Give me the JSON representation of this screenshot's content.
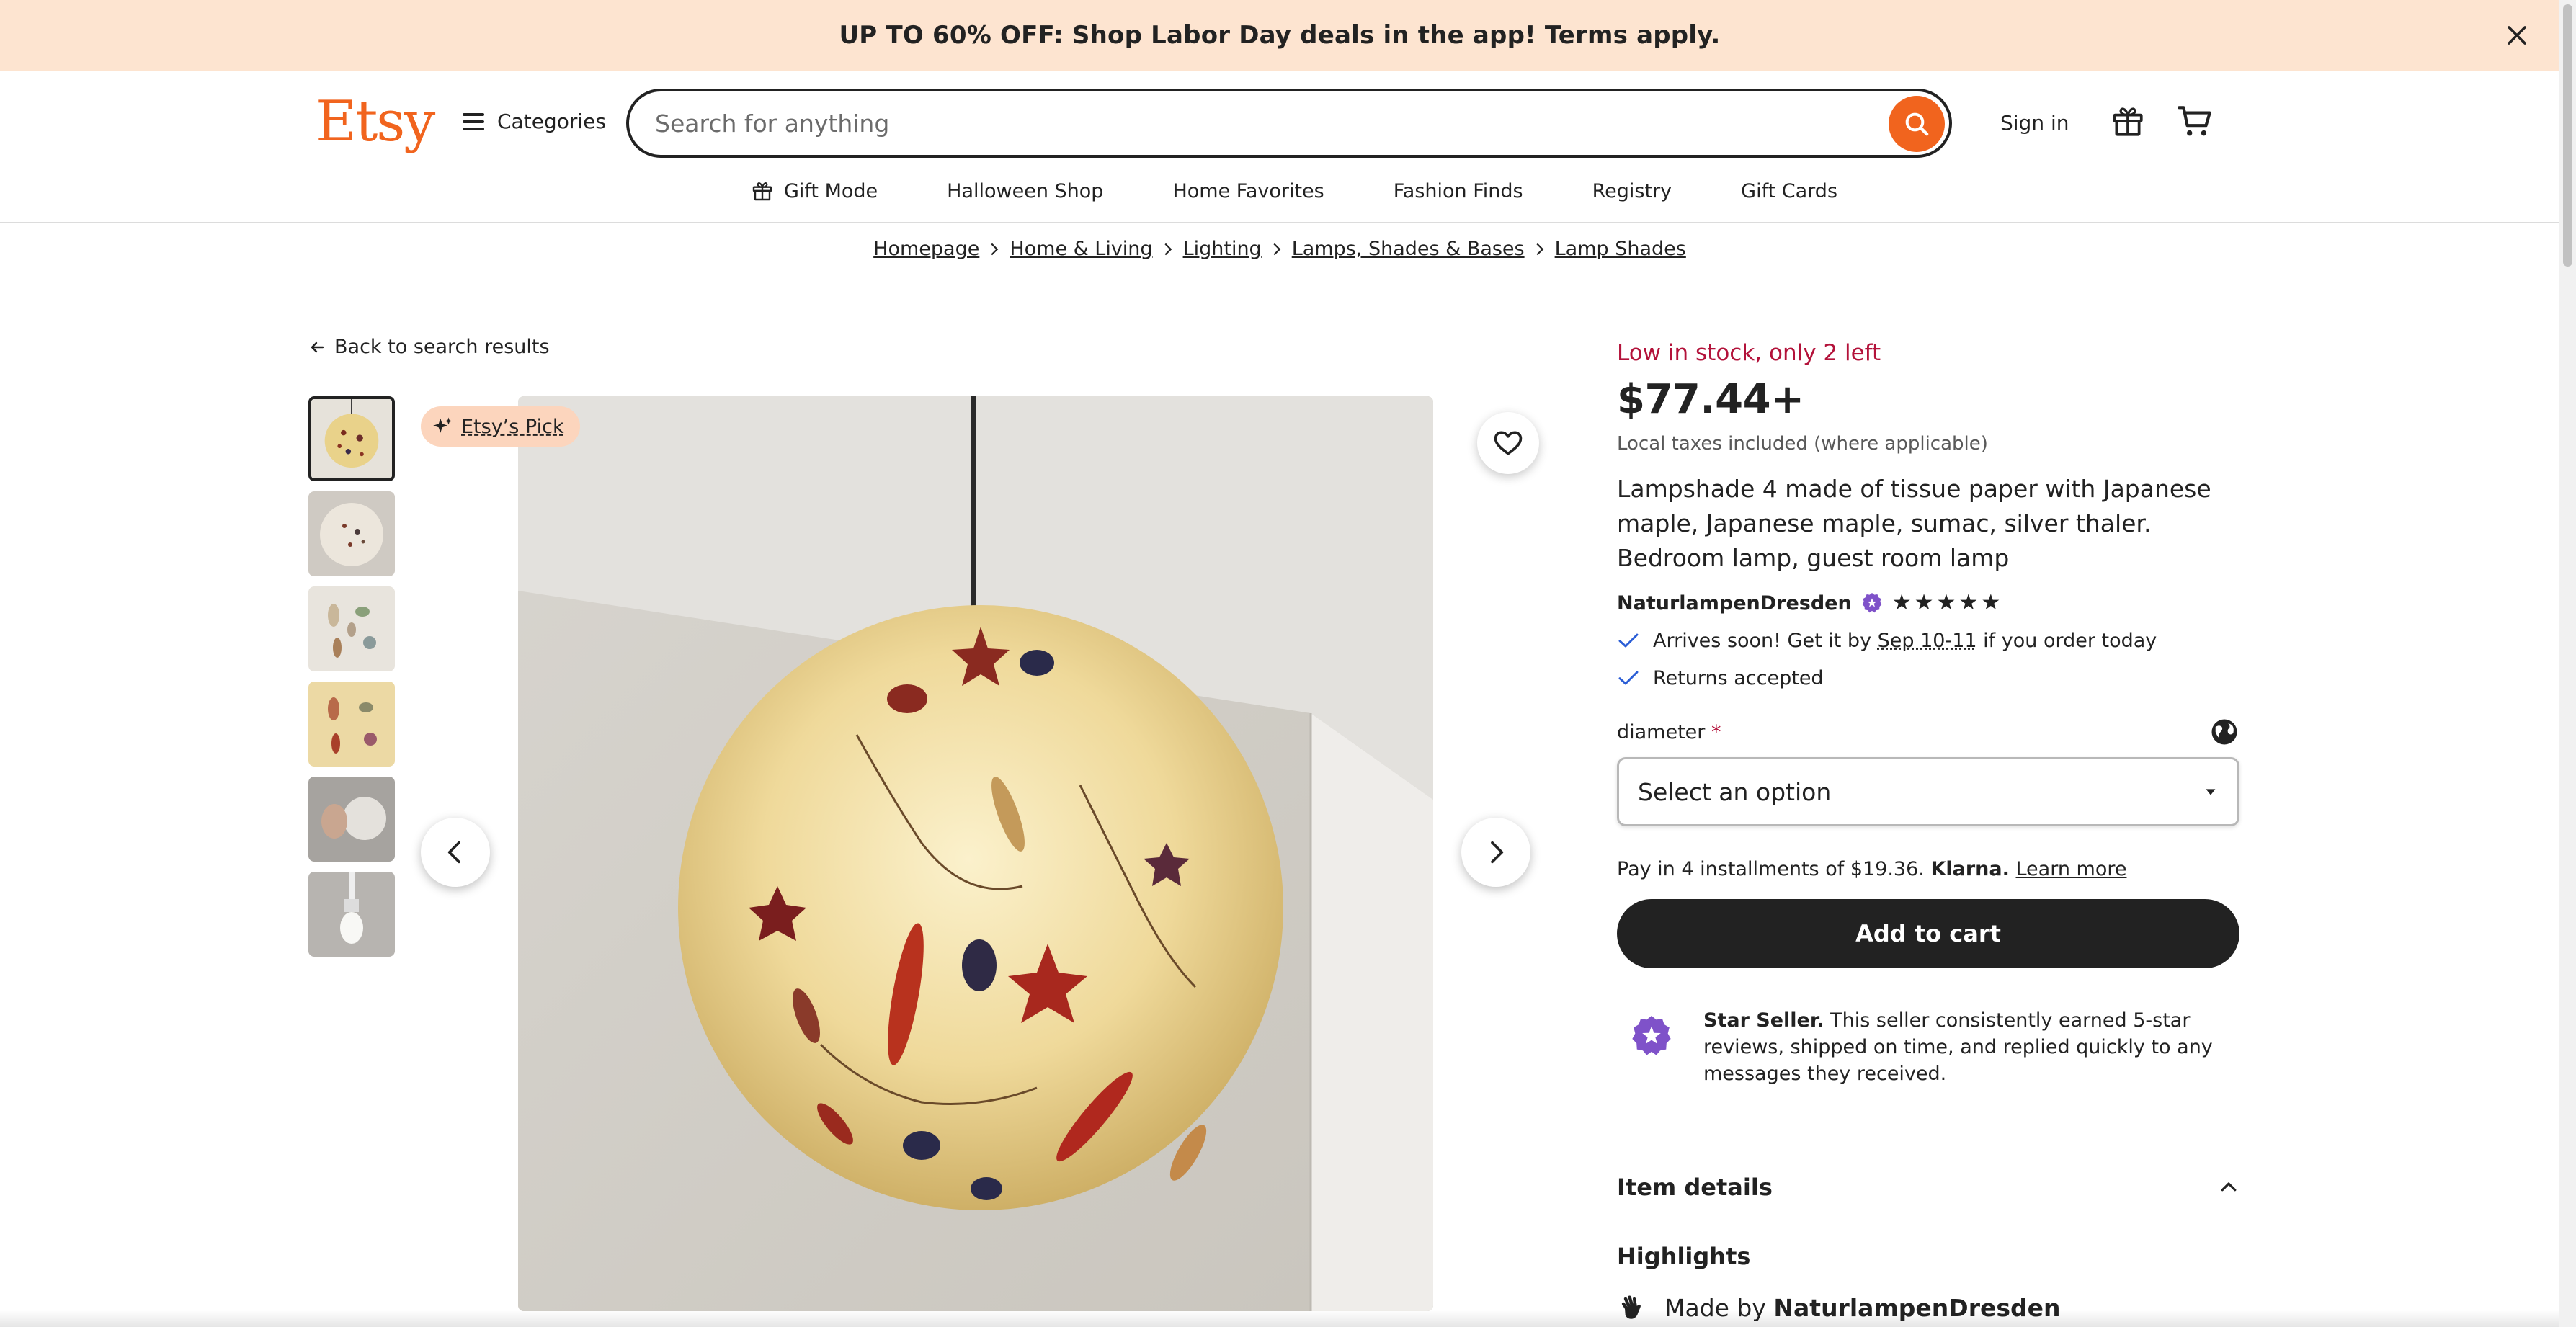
{
  "promo": {
    "text": "UP TO 60% OFF: Shop Labor Day deals in the app! Terms apply."
  },
  "header": {
    "logo": "Etsy",
    "categories": "Categories",
    "search_placeholder": "Search for anything",
    "sign_in": "Sign in"
  },
  "nav": {
    "items": [
      "Gift Mode",
      "Halloween Shop",
      "Home Favorites",
      "Fashion Finds",
      "Registry",
      "Gift Cards"
    ]
  },
  "breadcrumb": [
    "Homepage",
    "Home & Living",
    "Lighting",
    "Lamps, Shades & Bases",
    "Lamp Shades"
  ],
  "back_link": "Back to search results",
  "gallery": {
    "badge": "Etsy’s Pick",
    "thumbnail_count": 6,
    "active_index": 0
  },
  "product": {
    "stock": "Low in stock, only 2 left",
    "price": "$77.44+",
    "tax_note": "Local taxes included (where applicable)",
    "title": "Lampshade 4 made of tissue paper with Japanese maple, Japanese maple, sumac, silver thaler. Bedroom lamp, guest room lamp",
    "seller": "NaturlampenDresden",
    "rating_stars": 5,
    "delivery_prefix": "Arrives soon! Get it by ",
    "delivery_dates": "Sep 10-11",
    "delivery_suffix": " if you order today",
    "returns": "Returns accepted",
    "variation_label": "diameter",
    "variation_required": "*",
    "variation_placeholder": "Select an option",
    "klarna_prefix": "Pay in 4 installments of $19.36. ",
    "klarna_brand": "Klarna.",
    "klarna_link": "Learn more",
    "add_to_cart": "Add to cart",
    "star_seller_bold": "Star Seller.",
    "star_seller_text": " This seller consistently earned 5-star reviews, shipped on time, and replied quickly to any messages they received.",
    "item_details": "Item details",
    "highlights": "Highlights",
    "made_by_prefix": "Made by ",
    "made_by_name": "NaturlampenDresden"
  },
  "colors": {
    "brand": "#f1641e",
    "promo_bg": "#fde4d0",
    "stock_red": "#b3123a",
    "star_seller_purple": "#7f52c9",
    "check_blue": "#2b5ed6"
  }
}
